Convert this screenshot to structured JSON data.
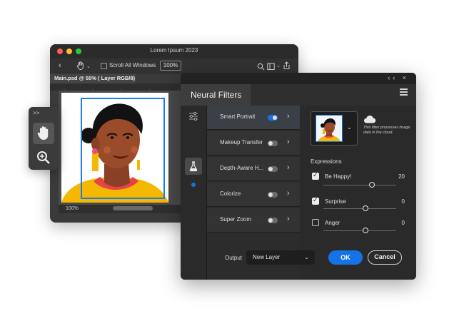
{
  "ps_window": {
    "title": "Lorem Ipsum 2023",
    "scroll_all_label": "Scroll All Windows",
    "zoom_value": "100%",
    "doc_tab": "Main.psd @ 50% ( Layer RGB/8)",
    "status_zoom": "100%"
  },
  "tools": {
    "collapse": ">>",
    "items": [
      "hand-icon",
      "zoom-icon"
    ]
  },
  "neural_filters": {
    "title": "Neural Filters",
    "topbar_icons": "‹‹ ×",
    "filters": [
      {
        "label": "Smart Portrait",
        "enabled": true,
        "active": true
      },
      {
        "label": "Makeup Transfer",
        "enabled": false,
        "active": false
      },
      {
        "label": "Depth-Aware H...",
        "enabled": false,
        "active": false
      },
      {
        "label": "Colorize",
        "enabled": false,
        "active": false
      },
      {
        "label": "Super Zoom",
        "enabled": false,
        "active": false
      }
    ],
    "cloud_note": "This filter processes image data in the cloud.",
    "expressions_title": "Expressions",
    "expressions": [
      {
        "label": "Be Happy!",
        "value": "20",
        "checked": true,
        "level": 0.63
      },
      {
        "label": "Surprise",
        "value": "0",
        "checked": true,
        "level": 0.54
      },
      {
        "label": "Anger",
        "value": "0",
        "checked": false,
        "level": 0.54
      }
    ],
    "output_label": "Output",
    "output_value": "New Layer",
    "ok_label": "OK",
    "cancel_label": "Cancel"
  },
  "colors": {
    "accent": "#1473e6",
    "panel_bg": "#262626",
    "shirt_yellow": "#f5b800",
    "collar_red": "#e8414a",
    "skin": "#9a4b2a"
  }
}
